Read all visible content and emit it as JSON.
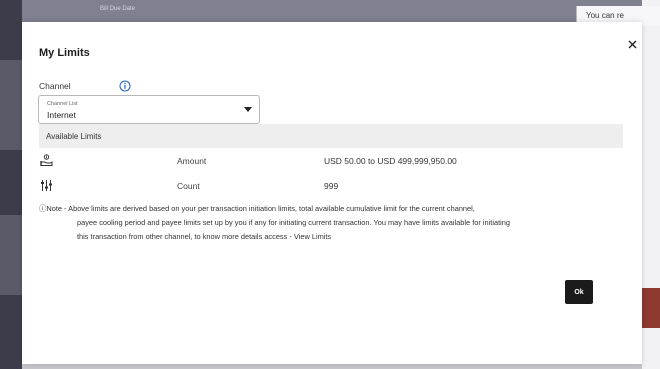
{
  "background": {
    "top_text": "Bill Due Date",
    "right_note": "You can re"
  },
  "modal": {
    "title": "My Limits",
    "close_icon": "close-icon",
    "channel": {
      "label": "Channel",
      "info_icon": "info-icon",
      "select_caption": "Channel List",
      "select_value": "Internet",
      "caret_icon": "caret-down-icon"
    },
    "limits_header": "Available Limits",
    "rows": [
      {
        "icon": "money-hand-icon",
        "label": "Amount",
        "value": "USD 50.00 to USD 499,999,950.00"
      },
      {
        "icon": "sliders-icon",
        "label": "Count",
        "value": "999"
      }
    ],
    "note": {
      "line1": "ⓘNote - Above limits are derived based on your  per transaction initiation limits, total available cumulative limit for the current channel,",
      "line2": "payee cooling period and payee limits set up by you if any for initiating current transaction.  You may have limits available for initiating",
      "line3": "this transaction from other channel, to know more details access - View Limits"
    },
    "ok_label": "Ok"
  },
  "colors": {
    "accent_info": "#1f5fbf",
    "button_dark": "#1b1b1b",
    "header_bg": "#eeeeee"
  }
}
